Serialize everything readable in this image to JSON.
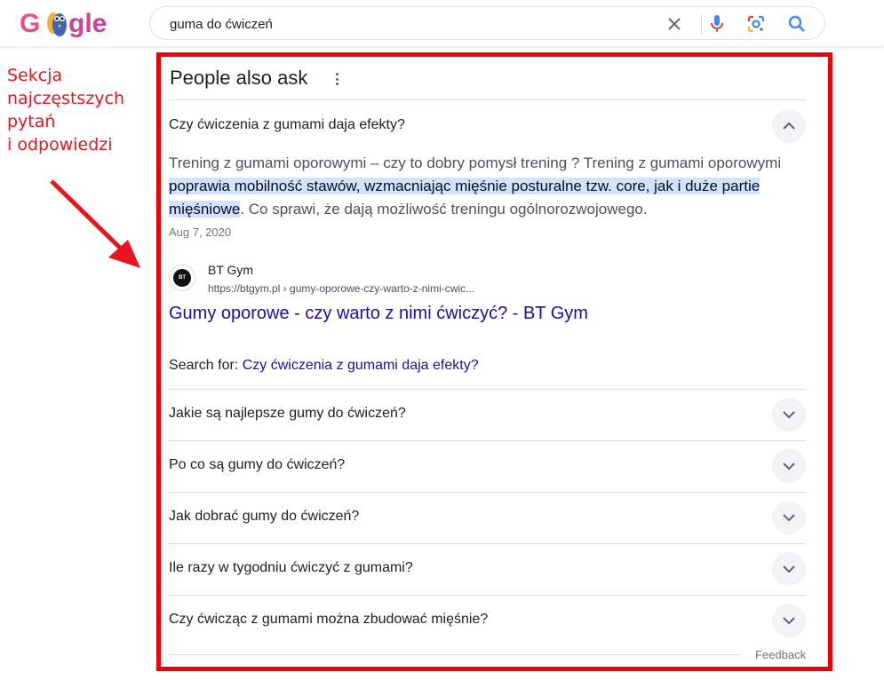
{
  "header": {
    "search_value": "guma do ćwiczeń",
    "search_placeholder": ""
  },
  "annotation": {
    "lines": [
      "Sekcja",
      "najczęstszych",
      "pytań",
      "i odpowiedzi"
    ]
  },
  "paa": {
    "title": "People also ask",
    "expanded": {
      "question": "Czy ćwiczenia z gumami daja efekty?",
      "answer_before": "Trening z gumami oporowymi – czy to dobry pomysł trening ? Trening z gumami oporowymi ",
      "answer_highlight": "poprawia mobilność stawów, wzmacniając mięśnie posturalne tzw. core, jak i duże partie mięśniowe",
      "answer_after": ". Co sprawi, że dają możliwość treningu ogólnorozwojowego.",
      "date": "Aug 7, 2020",
      "source_name": "BT Gym",
      "source_url": "https://btgym.pl › gumy-oporowe-czy-warto-z-nimi-cwic...",
      "favicon_text": "BT",
      "result_title": "Gumy oporowe - czy warto z nimi ćwiczyć? - BT Gym",
      "search_for_label": "Search for: ",
      "search_for_query": "Czy ćwiczenia z gumami daja efekty?"
    },
    "questions": [
      "Jakie są najlepsze gumy do ćwiczeń?",
      "Po co są gumy do ćwiczeń?",
      "Jak dobrać gumy do ćwiczeń?",
      "Ile razy w tygodniu ćwiczyć z gumami?",
      "Czy ćwicząc z gumami można zbudować mięśnie?"
    ],
    "feedback": "Feedback"
  },
  "colors": {
    "link": "#1a0dab",
    "highlight": "#d3e3fd",
    "annotation": "#e8141e",
    "frame": "#f00000"
  }
}
